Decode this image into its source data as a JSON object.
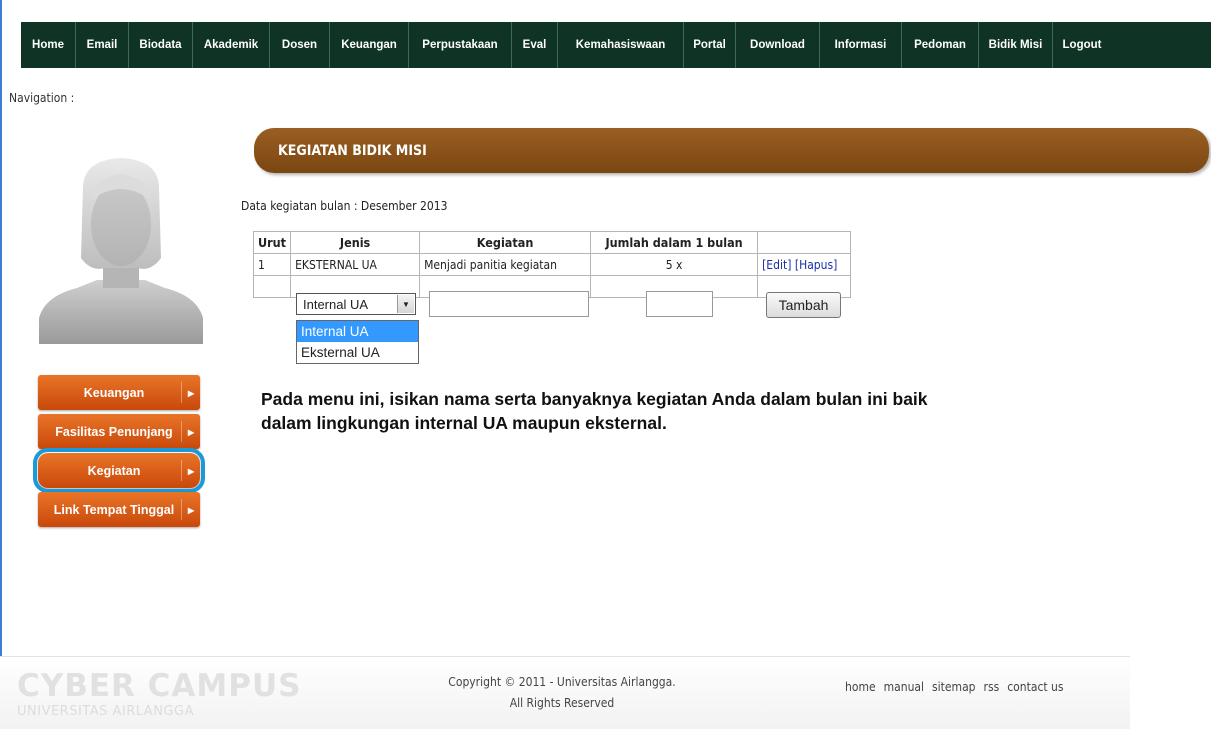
{
  "nav": [
    "Home",
    "Email",
    "Biodata",
    "Akademik",
    "Dosen",
    "Keuangan",
    "Perpustakaan",
    "Eval",
    "Kemahasiswaan",
    "Portal",
    "Download",
    "Informasi",
    "Pedoman",
    "Bidik Misi",
    "Logout"
  ],
  "navigation_label": "Navigation :",
  "sidebar": {
    "items": [
      {
        "label": "Keuangan"
      },
      {
        "label": "Fasilitas Penunjang"
      },
      {
        "label": "Kegiatan"
      },
      {
        "label": "Link Tempat Tinggal"
      }
    ]
  },
  "section_title": "KEGIATAN BIDIK MISI",
  "data_info": "Data kegiatan bulan : Desember 2013",
  "table": {
    "headers": [
      "Urut",
      "Jenis",
      "Kegiatan",
      "Jumlah dalam 1 bulan",
      ""
    ],
    "rows": [
      {
        "urut": "1",
        "jenis": "EKSTERNAL UA",
        "kegiatan": "Menjadi panitia kegiatan",
        "jumlah": "5 x",
        "edit": "[Edit]",
        "hapus": "[Hapus]"
      }
    ]
  },
  "form": {
    "selected": "Internal UA",
    "options": [
      "Internal UA",
      "Eksternal UA"
    ],
    "submit": "Tambah"
  },
  "instruction": "Pada menu ini, isikan nama serta banyaknya kegiatan Anda dalam bulan ini baik dalam lingkungan internal UA maupun eksternal.",
  "footer": {
    "logo_main": "CYBER CAMPUS",
    "logo_sub": "UNIVERSITAS AIRLANGGA",
    "copyright_line1": "Copyright © 2011 - Universitas Airlangga.",
    "copyright_line2": "All Rights Reserved",
    "links": [
      "home",
      "manual",
      "sitemap",
      "rss",
      "contact us"
    ]
  },
  "colors": {
    "nav_bg": "#0f3324",
    "title_bar": "#8a5219",
    "side_button": "#d85a16",
    "active_outline": "#1a9ad8",
    "dropdown_selected": "#3399ff"
  },
  "icons": {
    "avatar": "user-silhouette-icon",
    "side_arrow": "arrow-right-icon",
    "select_arrow": "chevron-down-icon"
  }
}
